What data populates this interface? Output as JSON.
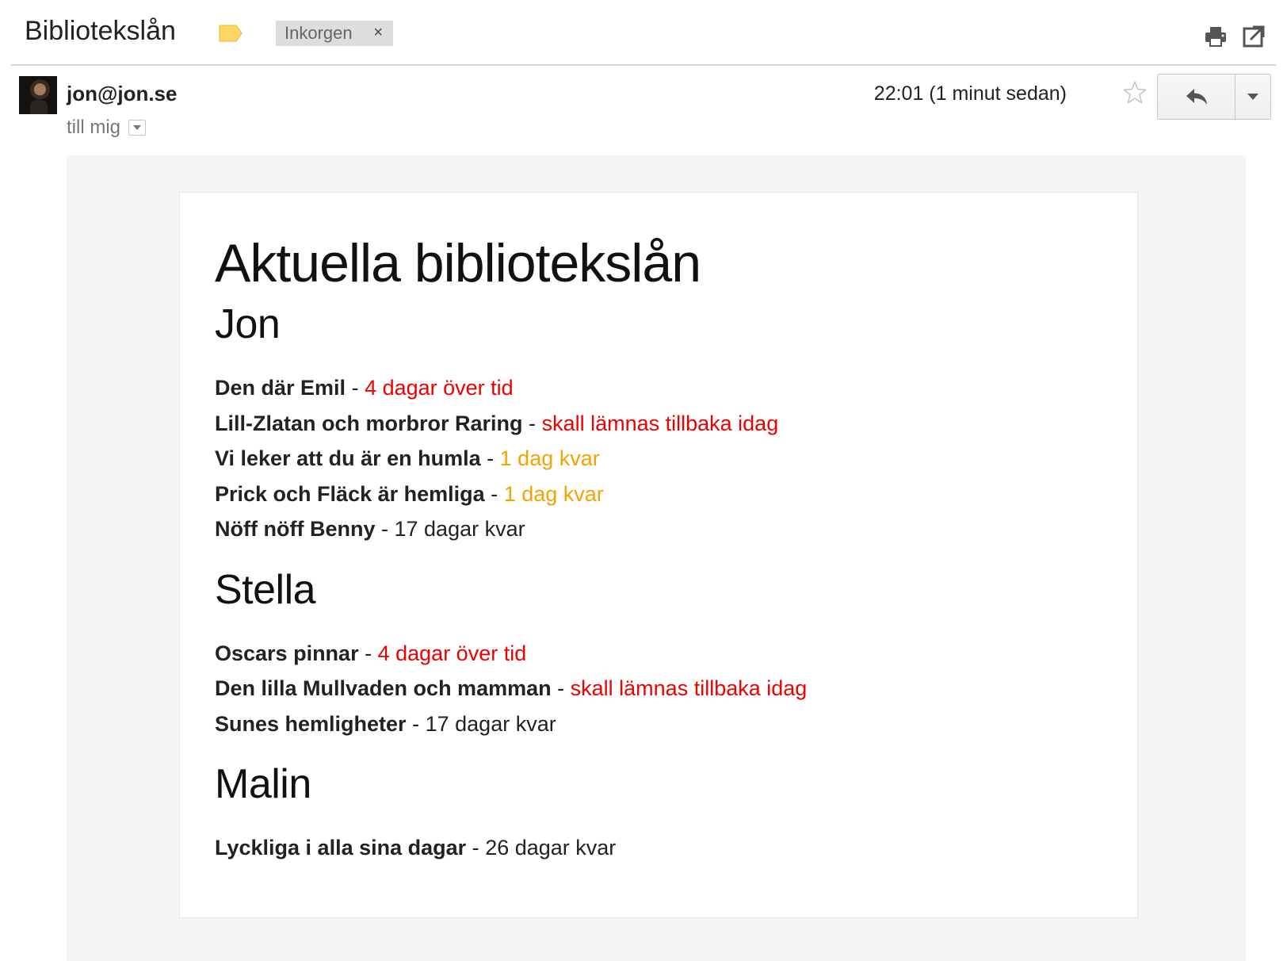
{
  "header": {
    "subject": "Bibliotekslån",
    "label_color": "#fdd663",
    "inbox_chip": {
      "label": "Inkorgen",
      "close_glyph": "×"
    },
    "icons": [
      "print-icon",
      "open-new-window-icon"
    ]
  },
  "message": {
    "sender": "jon@jon.se",
    "recipient": "till mig",
    "timestamp": "22:01 (1 minut sedan)",
    "icons": [
      "avatar",
      "star-icon",
      "reply-arrow-icon",
      "chevron-down-icon"
    ]
  },
  "content": {
    "title": "Aktuella bibliotekslån",
    "separator": "-",
    "colors": {
      "overdue": "#ee0000",
      "due_soon": "#f4a300",
      "normal": "#222222"
    },
    "people": [
      {
        "name": "Jon",
        "loans": [
          {
            "title": "Den där Emil",
            "status": "4 dagar över tid"
          },
          {
            "title": "Lill-Zlatan och morbror Raring",
            "status": "skall lämnas tillbaka idag"
          },
          {
            "title": "Vi leker att du är en humla",
            "status": "1 dag kvar"
          },
          {
            "title": "Prick och Fläck är hemliga",
            "status": "1 dag kvar"
          },
          {
            "title": "Nöff nöff Benny",
            "status": "17 dagar kvar"
          }
        ]
      },
      {
        "name": "Stella",
        "loans": [
          {
            "title": "Oscars pinnar",
            "status": "4 dagar över tid"
          },
          {
            "title": "Den lilla Mullvaden och mamman",
            "status": "skall lämnas tillbaka idag"
          },
          {
            "title": "Sunes hemligheter",
            "status": "17 dagar kvar"
          }
        ]
      },
      {
        "name": "Malin",
        "loans": [
          {
            "title": "Lyckliga i alla sina dagar",
            "status": "26 dagar kvar"
          }
        ]
      }
    ]
  }
}
